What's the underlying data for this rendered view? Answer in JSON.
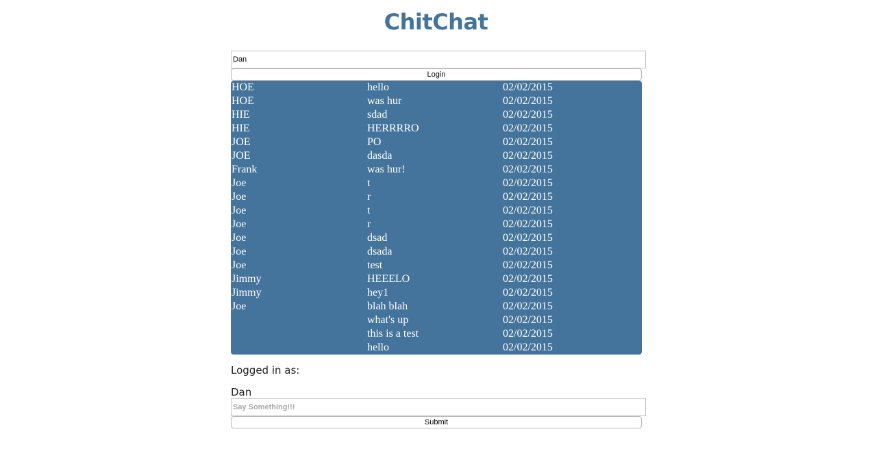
{
  "app": {
    "title": "ChitChat"
  },
  "login": {
    "name_value": "Dan",
    "button_label": "Login"
  },
  "messages": [
    {
      "user": "HOE",
      "text": "hello",
      "date": "02/02/2015"
    },
    {
      "user": "HOE",
      "text": "was hur",
      "date": "02/02/2015"
    },
    {
      "user": "HIE",
      "text": "sdad",
      "date": "02/02/2015"
    },
    {
      "user": "HIE",
      "text": "HERRRRO",
      "date": "02/02/2015"
    },
    {
      "user": "JOE",
      "text": "PO",
      "date": "02/02/2015"
    },
    {
      "user": "JOE",
      "text": "dasda",
      "date": "02/02/2015"
    },
    {
      "user": "Frank",
      "text": "was hur!",
      "date": "02/02/2015"
    },
    {
      "user": "Joe",
      "text": "t",
      "date": "02/02/2015"
    },
    {
      "user": "Joe",
      "text": "r",
      "date": "02/02/2015"
    },
    {
      "user": "Joe",
      "text": "t",
      "date": "02/02/2015"
    },
    {
      "user": "Joe",
      "text": "r",
      "date": "02/02/2015"
    },
    {
      "user": "Joe",
      "text": "dsad",
      "date": "02/02/2015"
    },
    {
      "user": "Joe",
      "text": "dsada",
      "date": "02/02/2015"
    },
    {
      "user": "Joe",
      "text": "test",
      "date": "02/02/2015"
    },
    {
      "user": "Jimmy",
      "text": "HEEELO",
      "date": "02/02/2015"
    },
    {
      "user": "Jimmy",
      "text": "hey1",
      "date": "02/02/2015"
    },
    {
      "user": "Joe",
      "text": "blah blah",
      "date": "02/02/2015"
    },
    {
      "user": "",
      "text": "what's up",
      "date": "02/02/2015"
    },
    {
      "user": "",
      "text": "this is a test",
      "date": "02/02/2015"
    },
    {
      "user": "",
      "text": "hello",
      "date": "02/02/2015"
    }
  ],
  "session": {
    "logged_in_label": "Logged in as:",
    "username": "Dan"
  },
  "composer": {
    "placeholder": "Say Something!!!",
    "submit_label": "Submit"
  },
  "colors": {
    "accent": "#44749b",
    "panel_text": "#ffffff"
  }
}
